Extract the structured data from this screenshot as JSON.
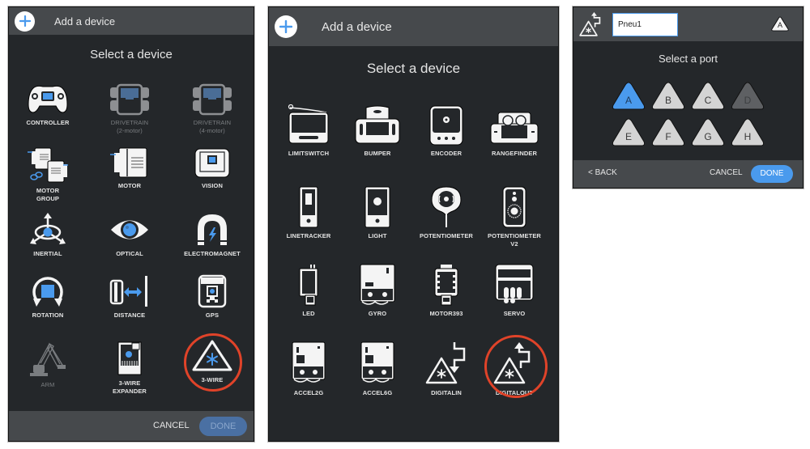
{
  "panel1": {
    "header_title": "Add a device",
    "subtitle": "Select a device",
    "devices": [
      {
        "label": "CONTROLLER",
        "sublabel": "",
        "icon": "controller-icon",
        "disabled": false
      },
      {
        "label": "DRIVETRAIN",
        "sublabel": "(2-motor)",
        "icon": "drivetrain-icon",
        "disabled": true
      },
      {
        "label": "DRIVETRAIN",
        "sublabel": "(4-motor)",
        "icon": "drivetrain-icon",
        "disabled": true
      },
      {
        "label": "MOTOR",
        "sublabel": "GROUP",
        "icon": "motor-group-icon",
        "disabled": false
      },
      {
        "label": "MOTOR",
        "sublabel": "",
        "icon": "motor-icon",
        "disabled": false
      },
      {
        "label": "VISION",
        "sublabel": "",
        "icon": "vision-icon",
        "disabled": false
      },
      {
        "label": "INERTIAL",
        "sublabel": "",
        "icon": "inertial-icon",
        "disabled": false
      },
      {
        "label": "OPTICAL",
        "sublabel": "",
        "icon": "eye-icon",
        "disabled": false
      },
      {
        "label": "ELECTROMAGNET",
        "sublabel": "",
        "icon": "magnet-icon",
        "disabled": false
      },
      {
        "label": "ROTATION",
        "sublabel": "",
        "icon": "rotation-icon",
        "disabled": false
      },
      {
        "label": "DISTANCE",
        "sublabel": "",
        "icon": "distance-icon",
        "disabled": false
      },
      {
        "label": "GPS",
        "sublabel": "",
        "icon": "gps-icon",
        "disabled": false
      },
      {
        "label": "ARM",
        "sublabel": "",
        "icon": "arm-icon",
        "disabled": true
      },
      {
        "label": "3-WIRE",
        "sublabel": "EXPANDER",
        "icon": "expander-icon",
        "disabled": false
      },
      {
        "label": "3-WIRE",
        "sublabel": "",
        "icon": "three-wire-icon",
        "disabled": false,
        "highlighted": true
      }
    ],
    "cancel_label": "CANCEL",
    "done_label": "DONE"
  },
  "panel2": {
    "header_title": "Add a device",
    "subtitle": "Select a device",
    "devices": [
      {
        "label": "LIMITSWITCH",
        "sublabel": "",
        "icon": "limitswitch-icon"
      },
      {
        "label": "BUMPER",
        "sublabel": "",
        "icon": "bumper-icon"
      },
      {
        "label": "ENCODER",
        "sublabel": "",
        "icon": "encoder-icon"
      },
      {
        "label": "RANGEFINDER",
        "sublabel": "",
        "icon": "rangefinder-icon"
      },
      {
        "label": "LINETRACKER",
        "sublabel": "",
        "icon": "linetracker-icon"
      },
      {
        "label": "LIGHT",
        "sublabel": "",
        "icon": "light-sensor-icon"
      },
      {
        "label": "POTENTIOMETER",
        "sublabel": "",
        "icon": "potentiometer-icon"
      },
      {
        "label": "POTENTIOMETER",
        "sublabel": "V2",
        "icon": "potentiometer-v2-icon"
      },
      {
        "label": "LED",
        "sublabel": "",
        "icon": "led-icon"
      },
      {
        "label": "GYRO",
        "sublabel": "",
        "icon": "gyro-icon"
      },
      {
        "label": "MOTOR393",
        "sublabel": "",
        "icon": "motor393-icon"
      },
      {
        "label": "SERVO",
        "sublabel": "",
        "icon": "servo-icon"
      },
      {
        "label": "ACCEL2G",
        "sublabel": "",
        "icon": "accel-icon"
      },
      {
        "label": "ACCEL6G",
        "sublabel": "",
        "icon": "accel-icon"
      },
      {
        "label": "DIGITALIN",
        "sublabel": "",
        "icon": "digital-in-icon"
      },
      {
        "label": "DIGITALOUT",
        "sublabel": "",
        "icon": "digital-out-icon",
        "highlighted": true
      }
    ]
  },
  "panel3": {
    "device_name_value": "Pneu1",
    "selected_port_badge": "A",
    "subtitle": "Select a port",
    "ports": [
      {
        "label": "A",
        "state": "selected"
      },
      {
        "label": "B",
        "state": "available"
      },
      {
        "label": "C",
        "state": "available"
      },
      {
        "label": "D",
        "state": "unavailable"
      },
      {
        "label": "E",
        "state": "available"
      },
      {
        "label": "F",
        "state": "available"
      },
      {
        "label": "G",
        "state": "available"
      },
      {
        "label": "H",
        "state": "available"
      }
    ],
    "back_label": "< BACK",
    "cancel_label": "CANCEL",
    "done_label": "DONE"
  },
  "colors": {
    "accent_blue": "#4a9aed",
    "highlight_red": "#e04329",
    "panel_bg": "#24272a",
    "header_bg": "#46494c"
  }
}
